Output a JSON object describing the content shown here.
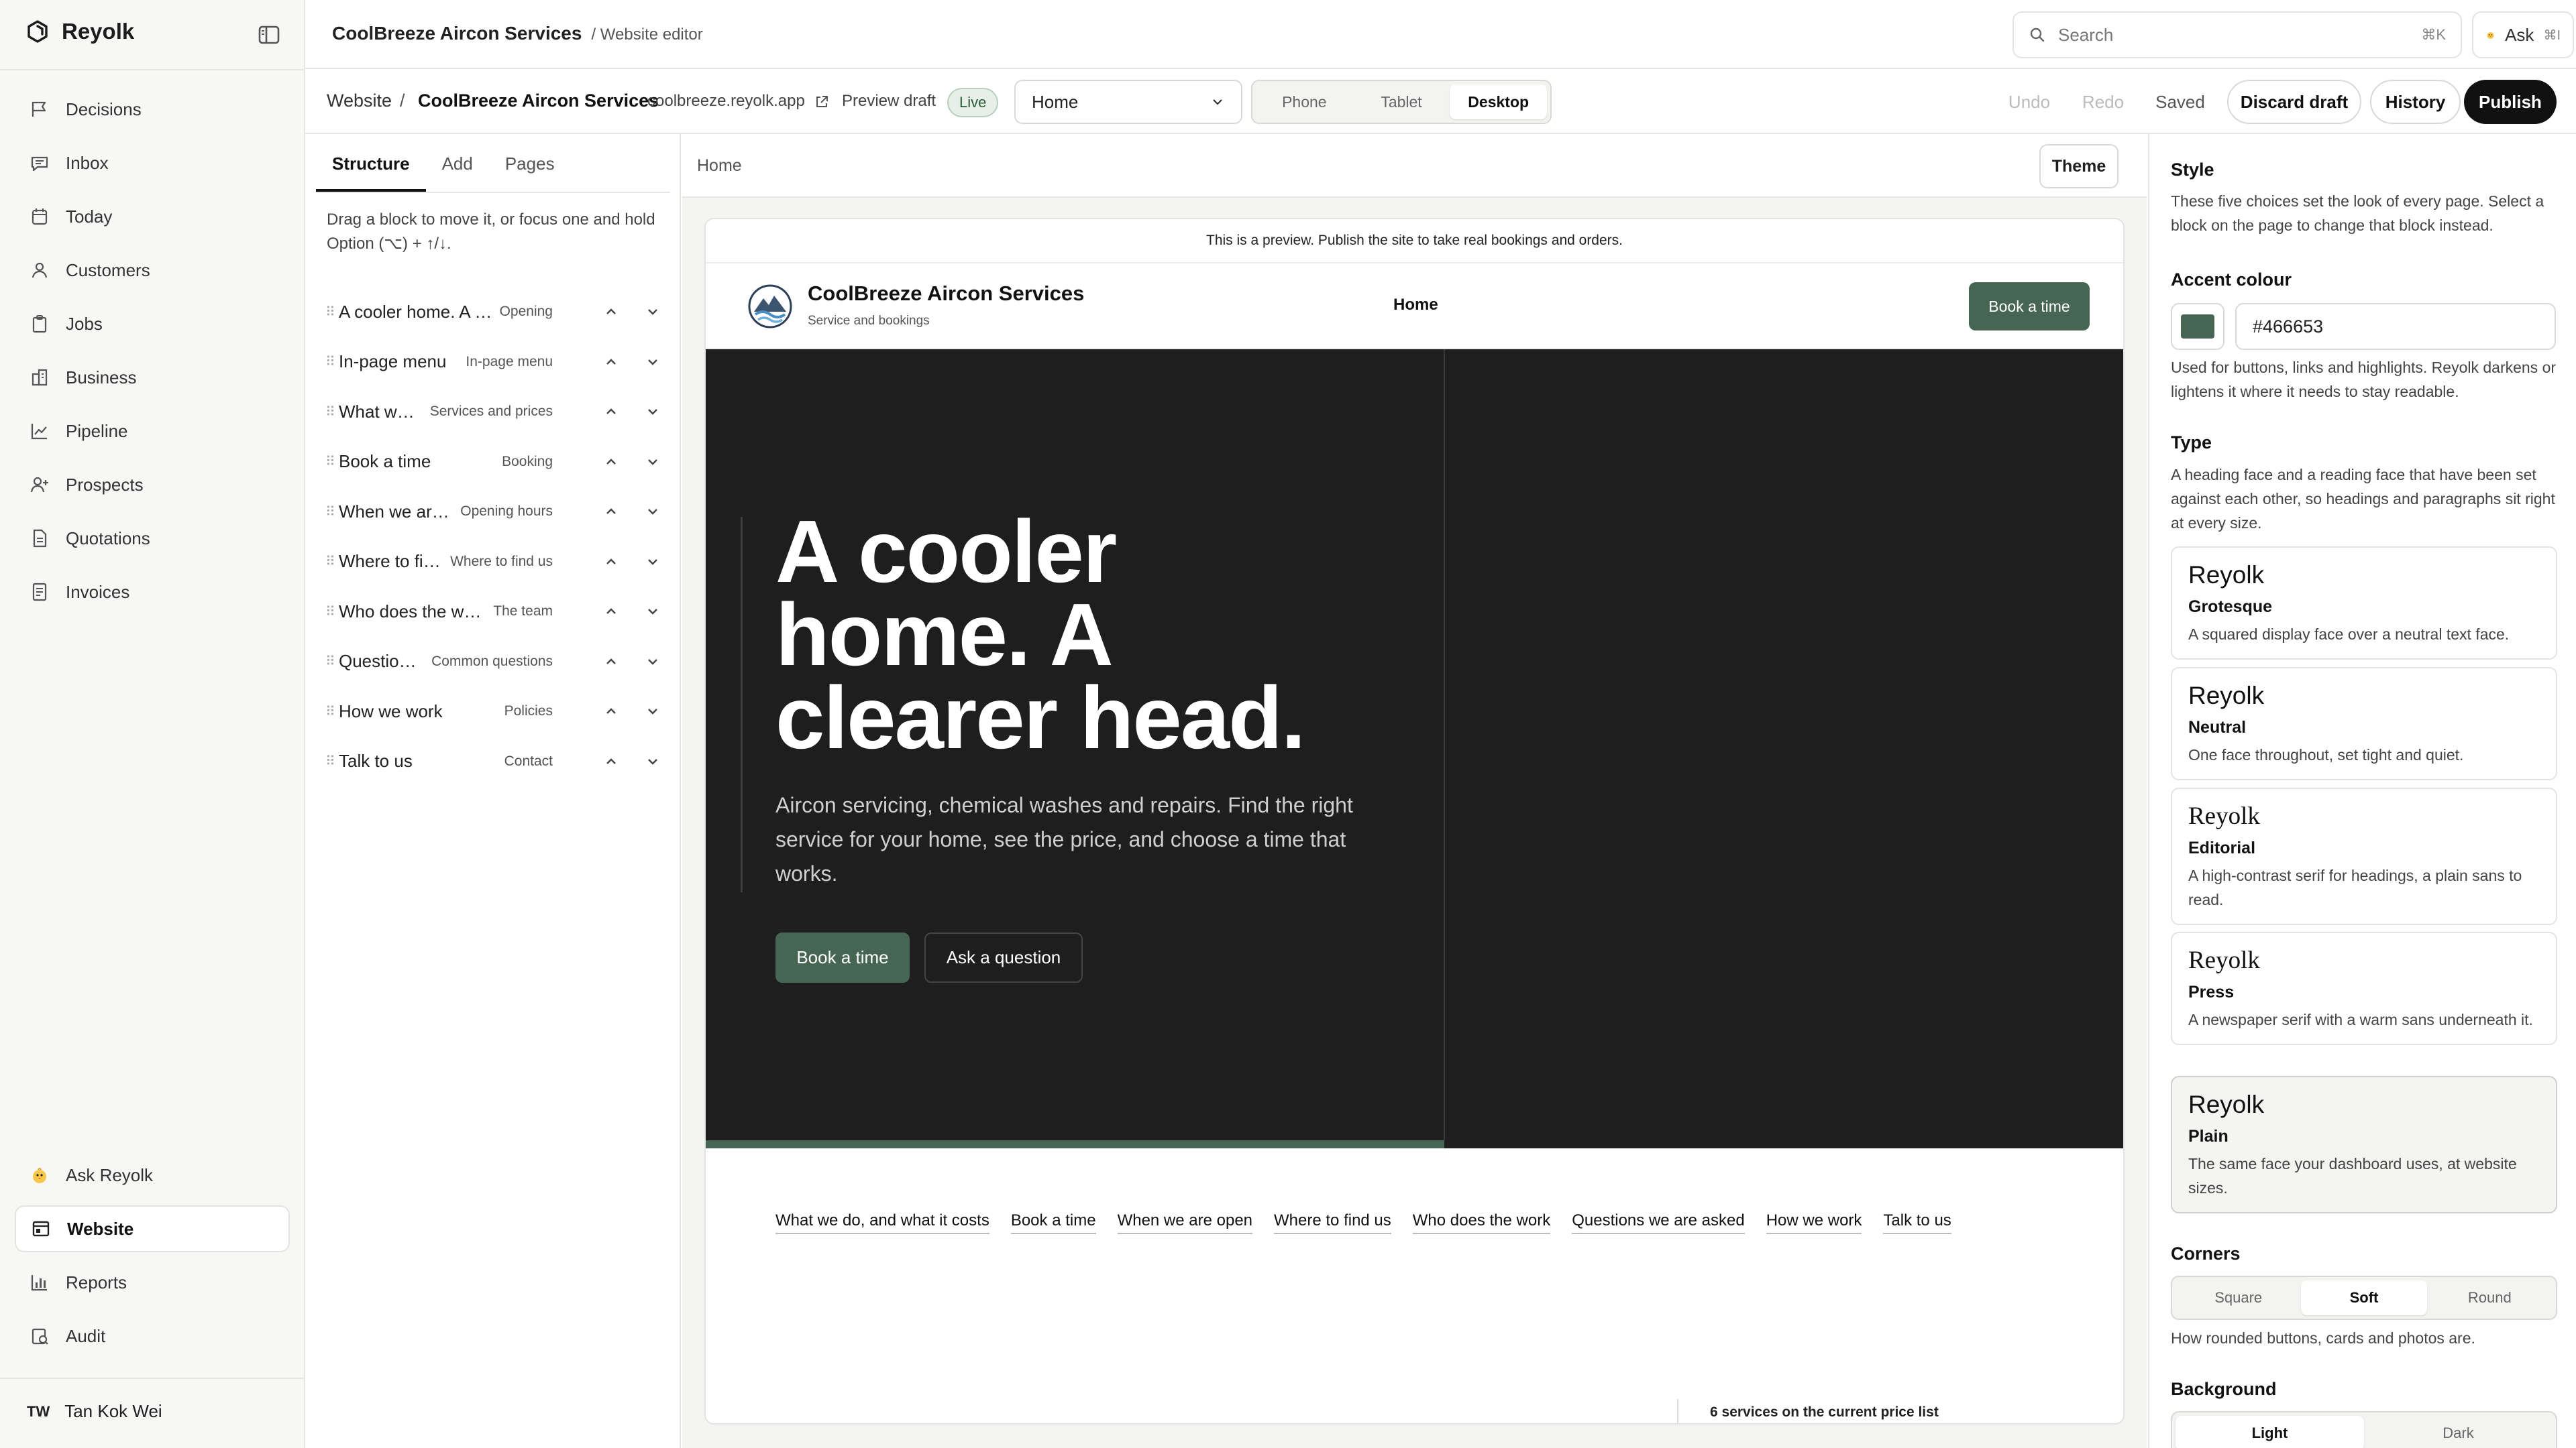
{
  "app": {
    "name": "Reyolk"
  },
  "sidebar": {
    "items": [
      {
        "label": "Decisions",
        "icon": "decisions-icon"
      },
      {
        "label": "Inbox",
        "icon": "inbox-icon"
      },
      {
        "label": "Today",
        "icon": "calendar-icon"
      },
      {
        "label": "Customers",
        "icon": "person-icon"
      },
      {
        "label": "Jobs",
        "icon": "clipboard-icon"
      },
      {
        "label": "Business",
        "icon": "building-icon"
      },
      {
        "label": "Pipeline",
        "icon": "chart-line-icon"
      },
      {
        "label": "Prospects",
        "icon": "person-add-icon"
      },
      {
        "label": "Quotations",
        "icon": "document-icon"
      },
      {
        "label": "Invoices",
        "icon": "invoice-icon"
      }
    ],
    "bottom_items": [
      {
        "label": "Ask Reyolk",
        "icon": "chick-icon"
      },
      {
        "label": "Website",
        "icon": "website-icon",
        "active": true
      },
      {
        "label": "Reports",
        "icon": "bar-chart-icon"
      },
      {
        "label": "Audit",
        "icon": "audit-icon"
      }
    ],
    "user": {
      "initials": "TW",
      "name": "Tan Kok Wei"
    }
  },
  "topbar": {
    "business": "CoolBreeze Aircon Services",
    "section": "/ Website editor",
    "search_placeholder": "Search",
    "search_shortcut": "⌘K",
    "ask_label": "Ask",
    "ask_shortcut": "⌘I"
  },
  "editor": {
    "crumb_root": "Website",
    "crumb_sep": "/",
    "crumb_site": "CoolBreeze Aircon Services",
    "domain": "coolbreeze.reyolk.app",
    "preview_label": "Preview draft",
    "status": "Live",
    "page_select": "Home",
    "devices": [
      "Phone",
      "Tablet",
      "Desktop"
    ],
    "active_device": "Desktop",
    "undo": "Undo",
    "redo": "Redo",
    "saved": "Saved",
    "discard": "Discard draft",
    "history": "History",
    "publish": "Publish"
  },
  "structure": {
    "tabs": [
      "Structure",
      "Add",
      "Pages"
    ],
    "hint": "Drag a block to move it, or focus one and hold Option (⌥) + ↑/↓.",
    "blocks": [
      {
        "title": "A cooler home. A clearer head.",
        "kind": "Opening"
      },
      {
        "title": "In-page menu",
        "kind": "In-page menu"
      },
      {
        "title": "What we do, and what it costs",
        "kind": "Services and prices"
      },
      {
        "title": "Book a time",
        "kind": "Booking"
      },
      {
        "title": "When we are open",
        "kind": "Opening hours"
      },
      {
        "title": "Where to find us",
        "kind": "Where to find us"
      },
      {
        "title": "Who does the work",
        "kind": "The team"
      },
      {
        "title": "Questions we are asked",
        "kind": "Common questions"
      },
      {
        "title": "How we work",
        "kind": "Policies"
      },
      {
        "title": "Talk to us",
        "kind": "Contact"
      }
    ]
  },
  "canvas": {
    "crumb": "Home",
    "theme_button": "Theme",
    "preview_note": "This is a preview. Publish the site to take real bookings and orders.",
    "site": {
      "name": "CoolBreeze Aircon Services",
      "tagline": "Service and bookings",
      "nav": "Home",
      "book_button": "Book a time",
      "hero_title": "A cooler home. A clearer head.",
      "hero_sub": "Aircon servicing, chemical washes and repairs. Find the right service for your home, see the price, and choose a time that works.",
      "hero_primary": "Book a time",
      "hero_secondary": "Ask a question",
      "hero_progress": 0.52,
      "menu": [
        "What we do, and what it costs",
        "Book a time",
        "When we are open",
        "Where to find us",
        "Who does the work",
        "Questions we are asked",
        "How we work",
        "Talk to us"
      ],
      "services_note": "6 services on the current price list"
    }
  },
  "style_panel": {
    "title": "Style",
    "intro": "These five choices set the look of every page. Select a block on the page to change that block instead.",
    "accent_title": "Accent colour",
    "accent_hex": "#466653",
    "accent_help": "Used for buttons, links and highlights. Reyolk darkens or lightens it where it needs to stay readable.",
    "type_title": "Type",
    "type_help": "A heading face and a reading face that have been set against each other, so headings and paragraphs sit right at every size.",
    "faces": [
      {
        "sample": "Reyolk",
        "name": "Grotesque",
        "desc": "A squared display face over a neutral text face."
      },
      {
        "sample": "Reyolk",
        "name": "Neutral",
        "desc": "One face throughout, set tight and quiet."
      },
      {
        "sample": "Reyolk",
        "name": "Editorial",
        "desc": "A high-contrast serif for headings, a plain sans to read."
      },
      {
        "sample": "Reyolk",
        "name": "Press",
        "desc": "A newspaper serif with a warm sans underneath it."
      },
      {
        "sample": "Reyolk",
        "name": "Plain",
        "desc": "The same face your dashboard uses, at website sizes.",
        "selected": true
      }
    ],
    "corners_title": "Corners",
    "corners": [
      "Square",
      "Soft",
      "Round"
    ],
    "corners_selected": "Soft",
    "corners_help": "How rounded buttons, cards and photos are.",
    "background_title": "Background",
    "backgrounds": [
      "Light",
      "Dark"
    ],
    "background_selected": "Light"
  },
  "colors": {
    "accent": "#466653",
    "hero_bg": "#1e1e1e",
    "primary": "#111111"
  }
}
